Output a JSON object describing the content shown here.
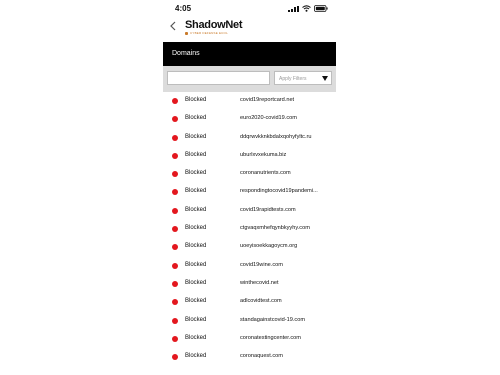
{
  "status_bar": {
    "time": "4:05"
  },
  "header": {
    "brand_name": "ShadowNet",
    "brand_tagline": "CYBER DEFENSE ECOL",
    "back_icon": "chevron-left-icon"
  },
  "section": {
    "title": "Domains"
  },
  "filters": {
    "search_value": "",
    "filter_placeholder": "Apply Filters",
    "dropdown_icon": "chevron-down-icon"
  },
  "colors": {
    "blocked": "#e3171e",
    "header_bg": "#000000",
    "filter_bar_bg": "#dcdcdc",
    "brand_accent": "#c97a2a"
  },
  "domains": [
    {
      "status": "Blocked",
      "domain": "covid19reportcard.net"
    },
    {
      "status": "Blocked",
      "domain": "euro2020-covid19.com"
    },
    {
      "status": "Blocked",
      "domain": "ddqrwvkknkbdalxqohyfyltc.ru"
    },
    {
      "status": "Blocked",
      "domain": "uburlxvxekuma.biz"
    },
    {
      "status": "Blocked",
      "domain": "coronanutrients.com"
    },
    {
      "status": "Blocked",
      "domain": "respondingtocovid19pandemi..."
    },
    {
      "status": "Blocked",
      "domain": "covid19rapidtests.com"
    },
    {
      "status": "Blocked",
      "domain": "ctgvaqxmhefqynbkyyhy.com"
    },
    {
      "status": "Blocked",
      "domain": "uoeyisoekkagoycm.org"
    },
    {
      "status": "Blocked",
      "domain": "covid19wine.com"
    },
    {
      "status": "Blocked",
      "domain": "winthecovid.net"
    },
    {
      "status": "Blocked",
      "domain": "adlcovidtest.com"
    },
    {
      "status": "Blocked",
      "domain": "standagainstcovid-19.com"
    },
    {
      "status": "Blocked",
      "domain": "coronatestingcenter.com"
    },
    {
      "status": "Blocked",
      "domain": "coronaquest.com"
    }
  ]
}
